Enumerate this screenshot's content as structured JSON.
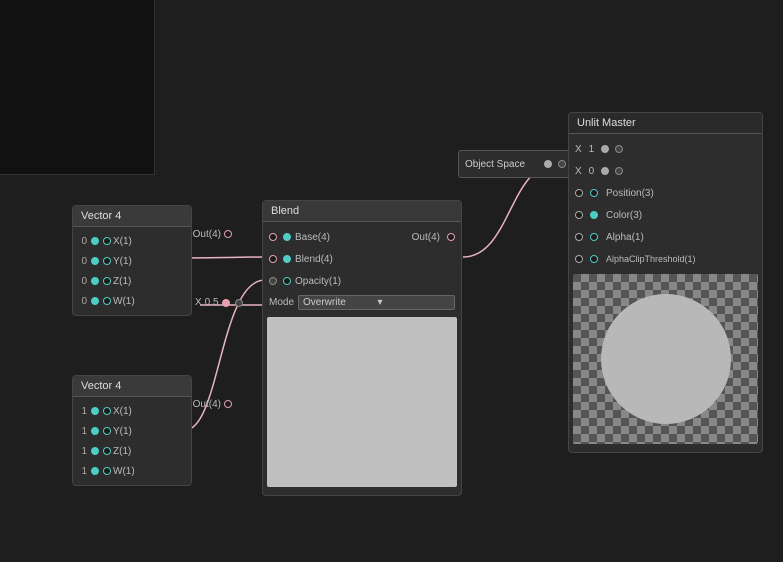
{
  "canvas": {
    "background": "#1e1e1e"
  },
  "top_left_box": {
    "visible": true
  },
  "vector4_node_1": {
    "title": "Vector 4",
    "rows": [
      {
        "label": "X",
        "value": "0",
        "socket_type": "cyan"
      },
      {
        "label": "Y",
        "value": "0",
        "socket_type": "cyan"
      },
      {
        "label": "Z",
        "value": "0",
        "socket_type": "cyan"
      },
      {
        "label": "W",
        "value": "0",
        "socket_type": "cyan"
      }
    ],
    "out_label": "Out(4)"
  },
  "vector4_node_2": {
    "title": "Vector 4",
    "rows": [
      {
        "label": "X",
        "value": "1",
        "socket_type": "cyan"
      },
      {
        "label": "Y",
        "value": "1",
        "socket_type": "cyan"
      },
      {
        "label": "Z",
        "value": "1",
        "socket_type": "cyan"
      },
      {
        "label": "W",
        "value": "1",
        "socket_type": "cyan"
      }
    ],
    "out_label": "Out(4)"
  },
  "blend_node": {
    "title": "Blend",
    "inputs": [
      {
        "label": "Base(4)",
        "radio": true
      },
      {
        "label": "Blend(4)",
        "radio": true
      },
      {
        "label": "Opacity(1)",
        "radio": false
      }
    ],
    "out_label": "Out(4)",
    "mode_label": "Mode",
    "mode_value": "Overwrite",
    "x_label": "X",
    "x_value": "0.5"
  },
  "object_space_node": {
    "label": "Object Space"
  },
  "unlit_master_node": {
    "title": "Unlit Master",
    "rows": [
      {
        "label": "Position(3)",
        "has_radio": true
      },
      {
        "label": "Color(3)",
        "has_radio": true,
        "filled": true
      },
      {
        "label": "Alpha(1)",
        "has_radio": false
      },
      {
        "label": "AlphaClipThreshold(1)",
        "has_radio": false
      }
    ],
    "x_rows": [
      {
        "label": "X",
        "value": "1"
      },
      {
        "label": "X",
        "value": "0"
      }
    ]
  },
  "icons": {
    "chevron": "▾",
    "dot": "•"
  }
}
